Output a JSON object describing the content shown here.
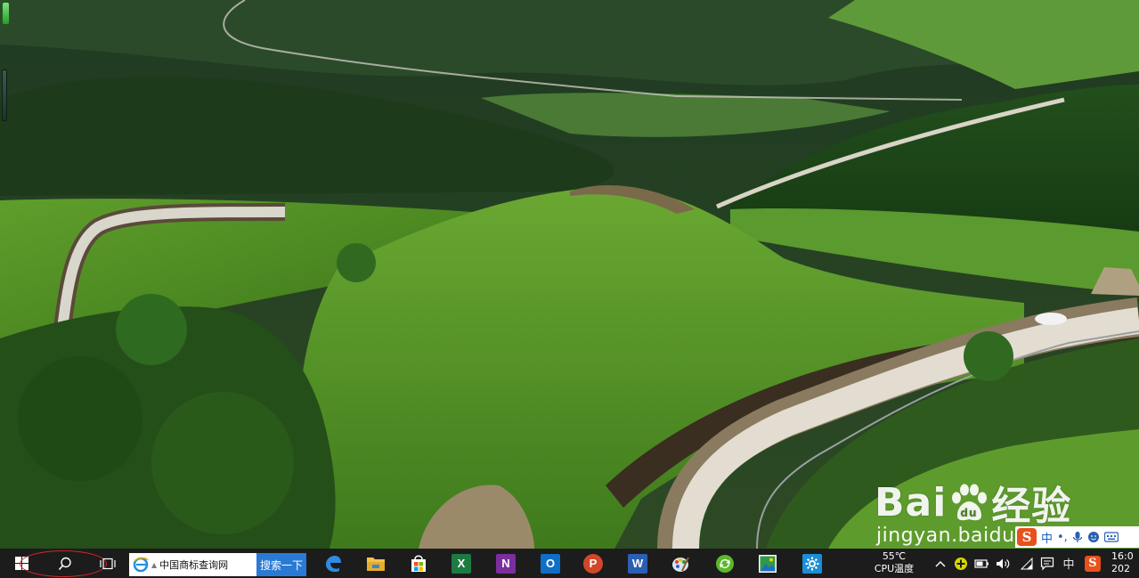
{
  "desktop": {
    "watermark": {
      "brand_left": "Bai",
      "brand_mid": "du",
      "brand_right": "经验",
      "url": "jingyan.baidu.com"
    },
    "ime_bar": {
      "logo": "S",
      "mode": "中",
      "punct": "•,",
      "icons": [
        "mic-icon",
        "emoji-icon",
        "keyboard-icon"
      ]
    }
  },
  "taskbar": {
    "start_icon": "windows-logo-icon",
    "search_icon": "search-icon",
    "task_view_icon": "task-view-icon",
    "address_bar": {
      "value": "中国商标查询网",
      "icon": "ie-icon"
    },
    "search_button": "搜索一下",
    "pinned_apps": [
      {
        "name": "edge",
        "icon": "edge-icon"
      },
      {
        "name": "file-explorer",
        "icon": "folder-icon"
      },
      {
        "name": "store",
        "icon": "store-icon"
      },
      {
        "name": "excel",
        "icon": "excel-icon",
        "letter": "X"
      },
      {
        "name": "onenote",
        "icon": "onenote-icon",
        "letter": "N"
      },
      {
        "name": "outlook",
        "icon": "outlook-icon",
        "letter": "O"
      },
      {
        "name": "powerpoint",
        "icon": "powerpoint-icon",
        "letter": "P"
      },
      {
        "name": "word",
        "icon": "word-icon",
        "letter": "W"
      },
      {
        "name": "paint",
        "icon": "paint-icon"
      },
      {
        "name": "sync-app",
        "icon": "sync-icon"
      },
      {
        "name": "photos",
        "icon": "photos-icon"
      },
      {
        "name": "settings",
        "icon": "gear-icon"
      }
    ],
    "temperature": {
      "value": "55℃",
      "label": "CPU温度"
    },
    "tray": {
      "chevron": "^",
      "ime_mode": "中",
      "icons": [
        "chevron-up-icon",
        "plus-badge-icon",
        "battery-icon",
        "volume-icon",
        "wifi-icon",
        "notification-icon",
        "ime-icon",
        "sogou-icon"
      ]
    },
    "clock": {
      "time": "16:0",
      "date": "202"
    }
  },
  "colors": {
    "taskbar_bg": "#1c1c1c",
    "search_button_bg": "#2a7ad5",
    "annotation_ellipse": "#d0262a",
    "ime_brand": "#e8501c"
  }
}
